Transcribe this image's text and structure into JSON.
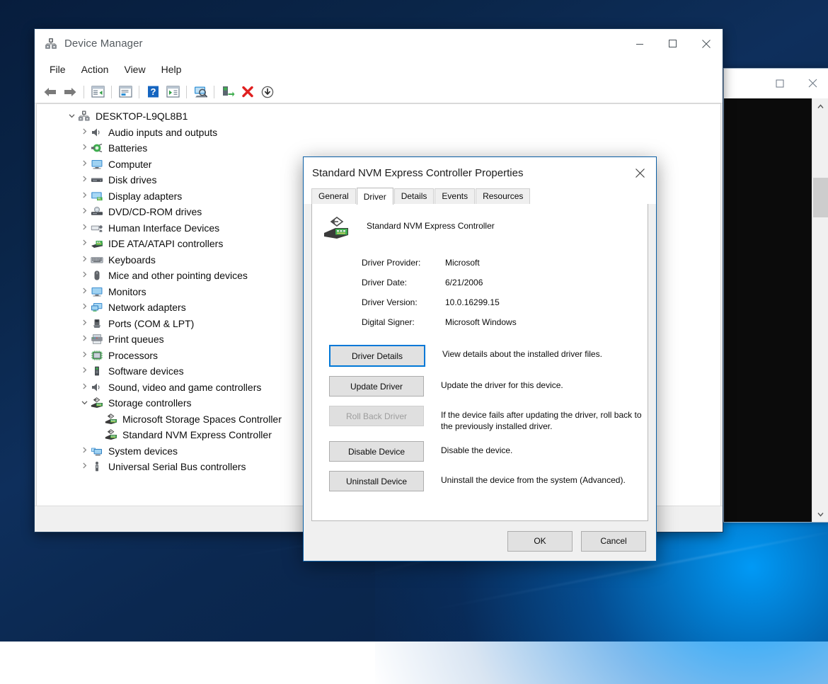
{
  "window": {
    "title": "Device Manager",
    "icon": "device-manager-icon",
    "controls": {
      "minimize": "─",
      "maximize": "☐",
      "close": "✕"
    },
    "menu": [
      "File",
      "Action",
      "View",
      "Help"
    ],
    "toolbar": [
      {
        "name": "back-icon",
        "label": "Back"
      },
      {
        "name": "forward-icon",
        "label": "Forward"
      },
      {
        "name": "separator",
        "label": ""
      },
      {
        "name": "show-hide-console-tree-icon",
        "label": "Show/Hide Console Tree"
      },
      {
        "name": "properties-icon",
        "label": "Properties"
      },
      {
        "name": "help-icon",
        "label": "Help"
      },
      {
        "name": "show-hide-action-pane-icon",
        "label": "Show/Hide Action Pane"
      },
      {
        "name": "scan-for-hardware-changes-icon",
        "label": "Scan for hardware changes"
      },
      {
        "name": "separator",
        "label": ""
      },
      {
        "name": "update-driver-icon",
        "label": "Update driver"
      },
      {
        "name": "uninstall-device-icon",
        "label": "Uninstall device"
      },
      {
        "name": "disable-device-icon",
        "label": "Disable device"
      }
    ],
    "statusbar": ""
  },
  "tree": {
    "root": {
      "label": "DESKTOP-L9QL8B1",
      "icon": "computer-root-icon",
      "expanded": true
    },
    "items": [
      {
        "label": "Audio inputs and outputs",
        "icon": "speaker-icon",
        "depth": 0,
        "expandable": true,
        "expanded": false
      },
      {
        "label": "Batteries",
        "icon": "battery-icon",
        "depth": 0,
        "expandable": true,
        "expanded": false
      },
      {
        "label": "Computer",
        "icon": "monitor-icon",
        "depth": 0,
        "expandable": true,
        "expanded": false
      },
      {
        "label": "Disk drives",
        "icon": "disk-drive-icon",
        "depth": 0,
        "expandable": true,
        "expanded": false
      },
      {
        "label": "Display adapters",
        "icon": "display-adapter-icon",
        "depth": 0,
        "expandable": true,
        "expanded": false
      },
      {
        "label": "DVD/CD-ROM drives",
        "icon": "dvd-drive-icon",
        "depth": 0,
        "expandable": true,
        "expanded": false
      },
      {
        "label": "Human Interface Devices",
        "icon": "hid-icon",
        "depth": 0,
        "expandable": true,
        "expanded": false
      },
      {
        "label": "IDE ATA/ATAPI controllers",
        "icon": "ide-controller-icon",
        "depth": 0,
        "expandable": true,
        "expanded": false
      },
      {
        "label": "Keyboards",
        "icon": "keyboard-icon",
        "depth": 0,
        "expandable": true,
        "expanded": false
      },
      {
        "label": "Mice and other pointing devices",
        "icon": "mouse-icon",
        "depth": 0,
        "expandable": true,
        "expanded": false
      },
      {
        "label": "Monitors",
        "icon": "monitor-icon",
        "depth": 0,
        "expandable": true,
        "expanded": false
      },
      {
        "label": "Network adapters",
        "icon": "network-adapter-icon",
        "depth": 0,
        "expandable": true,
        "expanded": false
      },
      {
        "label": "Ports (COM & LPT)",
        "icon": "port-icon",
        "depth": 0,
        "expandable": true,
        "expanded": false
      },
      {
        "label": "Print queues",
        "icon": "printer-icon",
        "depth": 0,
        "expandable": true,
        "expanded": false
      },
      {
        "label": "Processors",
        "icon": "processor-icon",
        "depth": 0,
        "expandable": true,
        "expanded": false
      },
      {
        "label": "Software devices",
        "icon": "software-device-icon",
        "depth": 0,
        "expandable": true,
        "expanded": false
      },
      {
        "label": "Sound, video and game controllers",
        "icon": "speaker-icon",
        "depth": 0,
        "expandable": true,
        "expanded": false
      },
      {
        "label": "Storage controllers",
        "icon": "storage-controller-icon",
        "depth": 0,
        "expandable": true,
        "expanded": true
      },
      {
        "label": "Microsoft Storage Spaces Controller",
        "icon": "storage-controller-icon",
        "depth": 1,
        "expandable": false,
        "expanded": false
      },
      {
        "label": "Standard NVM Express Controller",
        "icon": "storage-controller-icon",
        "depth": 1,
        "expandable": false,
        "expanded": false
      },
      {
        "label": "System devices",
        "icon": "system-device-icon",
        "depth": 0,
        "expandable": true,
        "expanded": false
      },
      {
        "label": "Universal Serial Bus controllers",
        "icon": "usb-icon",
        "depth": 0,
        "expandable": true,
        "expanded": false
      }
    ]
  },
  "dialog": {
    "title": "Standard NVM Express Controller Properties",
    "close_glyph": "✕",
    "tabs": [
      {
        "label": "General",
        "active": false
      },
      {
        "label": "Driver",
        "active": true
      },
      {
        "label": "Details",
        "active": false
      },
      {
        "label": "Events",
        "active": false
      },
      {
        "label": "Resources",
        "active": false
      }
    ],
    "device_name": "Standard NVM Express Controller",
    "device_icon": "storage-controller-icon",
    "info": [
      {
        "label": "Driver Provider:",
        "value": "Microsoft"
      },
      {
        "label": "Driver Date:",
        "value": "6/21/2006"
      },
      {
        "label": "Driver Version:",
        "value": "10.0.16299.15"
      },
      {
        "label": "Digital Signer:",
        "value": "Microsoft Windows"
      }
    ],
    "actions": [
      {
        "label": "Driver Details",
        "desc": "View details about the installed driver files.",
        "state": "focused"
      },
      {
        "label": "Update Driver",
        "desc": "Update the driver for this device.",
        "state": "normal"
      },
      {
        "label": "Roll Back Driver",
        "desc": "If the device fails after updating the driver, roll back to the previously installed driver.",
        "state": "disabled"
      },
      {
        "label": "Disable Device",
        "desc": "Disable the device.",
        "state": "normal"
      },
      {
        "label": "Uninstall Device",
        "desc": "Uninstall the device from the system (Advanced).",
        "state": "normal"
      }
    ],
    "footer": {
      "ok": "OK",
      "cancel": "Cancel"
    },
    "accent_color": "#0b5fa5",
    "focus_color": "#0078d7"
  },
  "background_window": {
    "controls": {
      "maximize": "☐",
      "close": "✕"
    },
    "scrollbar": {
      "up": "⌃",
      "down": "⌄"
    }
  }
}
